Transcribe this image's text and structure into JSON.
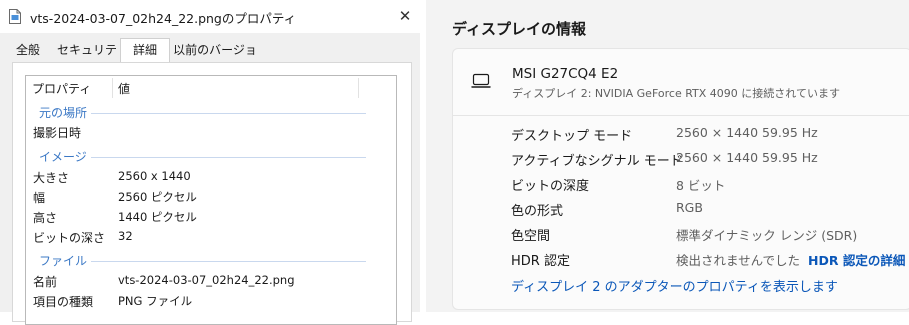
{
  "dialog": {
    "title": "vts-2024-03-07_02h24_22.pngのプロパティ",
    "close_glyph": "✕",
    "tabs": [
      "全般",
      "セキュリティ",
      "詳細",
      "以前のバージョン"
    ],
    "active_tab": "詳細",
    "columns": [
      "プロパティ",
      "値"
    ],
    "groups": {
      "origin": "元の場所",
      "image": "イメージ",
      "file": "ファイル"
    },
    "rows": {
      "date_taken": {
        "key": "撮影日時",
        "value": ""
      },
      "dimensions": {
        "key": "大きさ",
        "value": "2560 x 1440"
      },
      "width": {
        "key": "幅",
        "value": "2560 ピクセル"
      },
      "height": {
        "key": "高さ",
        "value": "1440 ピクセル"
      },
      "bit_depth": {
        "key": "ビットの深さ",
        "value": "32"
      },
      "name": {
        "key": "名前",
        "value": "vts-2024-03-07_02h24_22.png"
      },
      "item_type": {
        "key": "項目の種類",
        "value": "PNG ファイル"
      }
    }
  },
  "settings": {
    "title": "ディスプレイの情報",
    "monitor_name": "MSI G27CQ4 E2",
    "monitor_subtitle": "ディスプレイ 2: NVIDIA GeForce RTX 4090 に接続されています",
    "rows": [
      {
        "key": "デスクトップ モード",
        "value": "2560 × 1440 59.95 Hz"
      },
      {
        "key": "アクティブなシグナル モード",
        "value": "2560 × 1440 59.95 Hz"
      },
      {
        "key": "ビットの深度",
        "value": "8 ビット"
      },
      {
        "key": "色の形式",
        "value": "RGB"
      },
      {
        "key": "色空間",
        "value": "標準ダイナミック レンジ (SDR)"
      },
      {
        "key": "HDR 認定",
        "value": "検出されませんでした",
        "link": "HDR 認定の詳細"
      }
    ],
    "adapter_link": "ディスプレイ 2 のアダプターのプロパティを表示します"
  },
  "colors": {
    "link": "#0b57b8",
    "group_header": "#3b78c5"
  }
}
